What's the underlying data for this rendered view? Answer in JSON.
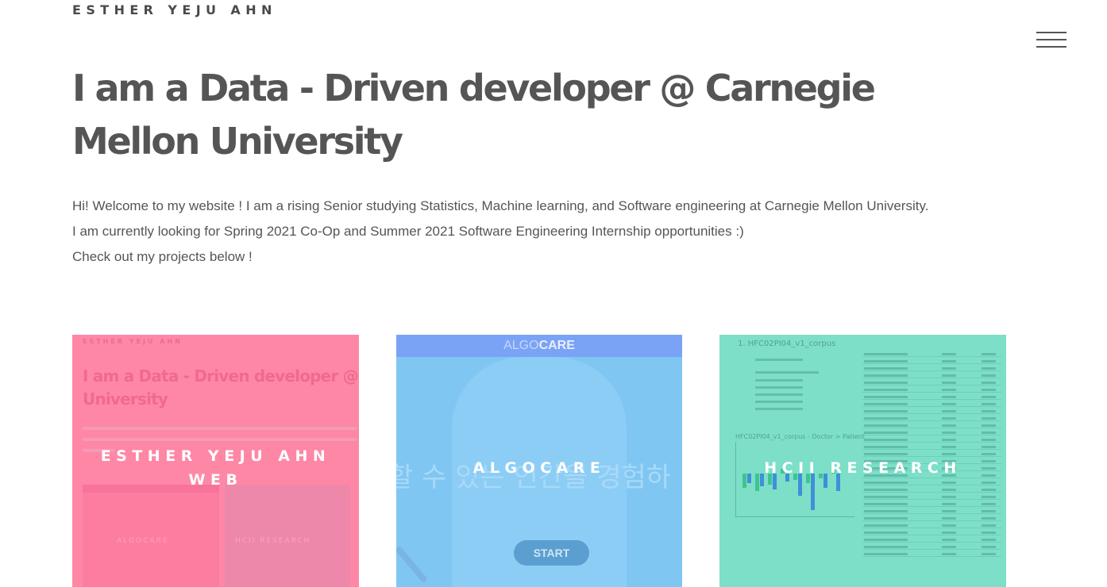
{
  "header": {
    "site_name": "ESTHER YEJU AHN",
    "menu_icon": "hamburger-menu-icon"
  },
  "hero": {
    "headline": "I am a Data - Driven developer @ Carnegie Mellon University",
    "intro_lines": [
      "Hi! Welcome to my website ! I am a rising Senior studying Statistics, Machine learning, and Software engineering at Carnegie Mellon University.",
      "I am currently looking for Spring 2021 Co-Op and Summer 2021 Software Engineering Internship opportunities :)",
      "Check out my projects below !"
    ]
  },
  "projects": [
    {
      "title": "ESTHER YEJU AHN WEB",
      "overlay_color": "#fe87a5",
      "preview": {
        "site_name": "ESTHER YEJU AHN",
        "headline_line1": "I am a Data - Driven developer @ Carnegie",
        "headline_line2": "University",
        "tile_labels": [
          "ALGOCARE",
          "HCII RESEARCH"
        ]
      }
    },
    {
      "title": "ALGOCARE",
      "overlay_color": "#7fc6f3",
      "preview": {
        "logo_light": "ALGO",
        "logo_bold": "CARE",
        "korean_text": "할 수 있는 인간을 경험하",
        "start_label": "START"
      }
    },
    {
      "title": "HCII RESEARCH",
      "overlay_color": "#7ddfc8",
      "preview": {
        "doc_title": "1.  HFC02PI04_v1_corpus",
        "chart_title": "HFC02PI04_v1_corpus - Doctor > Patient"
      }
    }
  ]
}
